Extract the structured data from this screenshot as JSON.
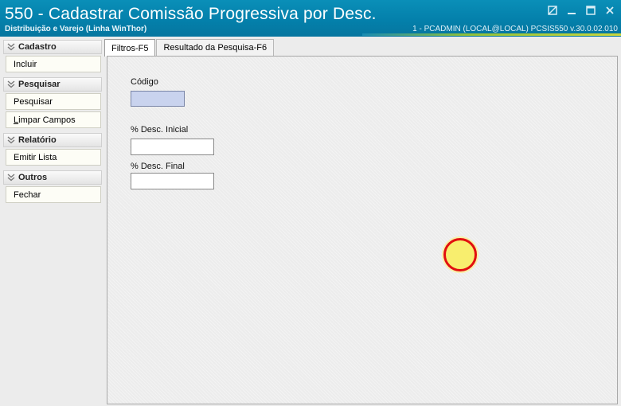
{
  "window": {
    "title": "550 - Cadastrar Comissão Progressiva por Desc.",
    "subtitle": "Distribuição e Varejo (Linha WinThor)",
    "status": "1 - PCADMIN (LOCAL@LOCAL)   PCSIS550  v.30.0.02.010"
  },
  "sidebar": {
    "groups": [
      {
        "label": "Cadastro",
        "icon": "chevron-double-down-icon",
        "items": [
          {
            "label": "Incluir"
          }
        ]
      },
      {
        "label": "Pesquisar",
        "icon": "chevron-double-down-icon",
        "items": [
          {
            "label": "Pesquisar"
          },
          {
            "label_first": "L",
            "label_rest": "impar Campos"
          }
        ]
      },
      {
        "label": "Relatório",
        "icon": "chevron-double-down-icon",
        "items": [
          {
            "label": "Emitir Lista"
          }
        ]
      },
      {
        "label": "Outros",
        "icon": "chevron-double-down-icon",
        "items": [
          {
            "label": "Fechar"
          }
        ]
      }
    ]
  },
  "tabs": [
    {
      "label": "Filtros-F5",
      "active": true
    },
    {
      "label": "Resultado da Pesquisa-F6",
      "active": false
    }
  ],
  "filters": {
    "codigo_label": "Código",
    "codigo_value": "",
    "desc_inicial_label": "% Desc. Inicial",
    "desc_inicial_value": "",
    "desc_final_label": "% Desc. Final",
    "desc_final_value": ""
  },
  "colors": {
    "titlebar": "#0480ab",
    "focused_input": "#c9d3ee",
    "marker_fill": "#f8ee6e",
    "marker_ring": "#e20f0f"
  }
}
